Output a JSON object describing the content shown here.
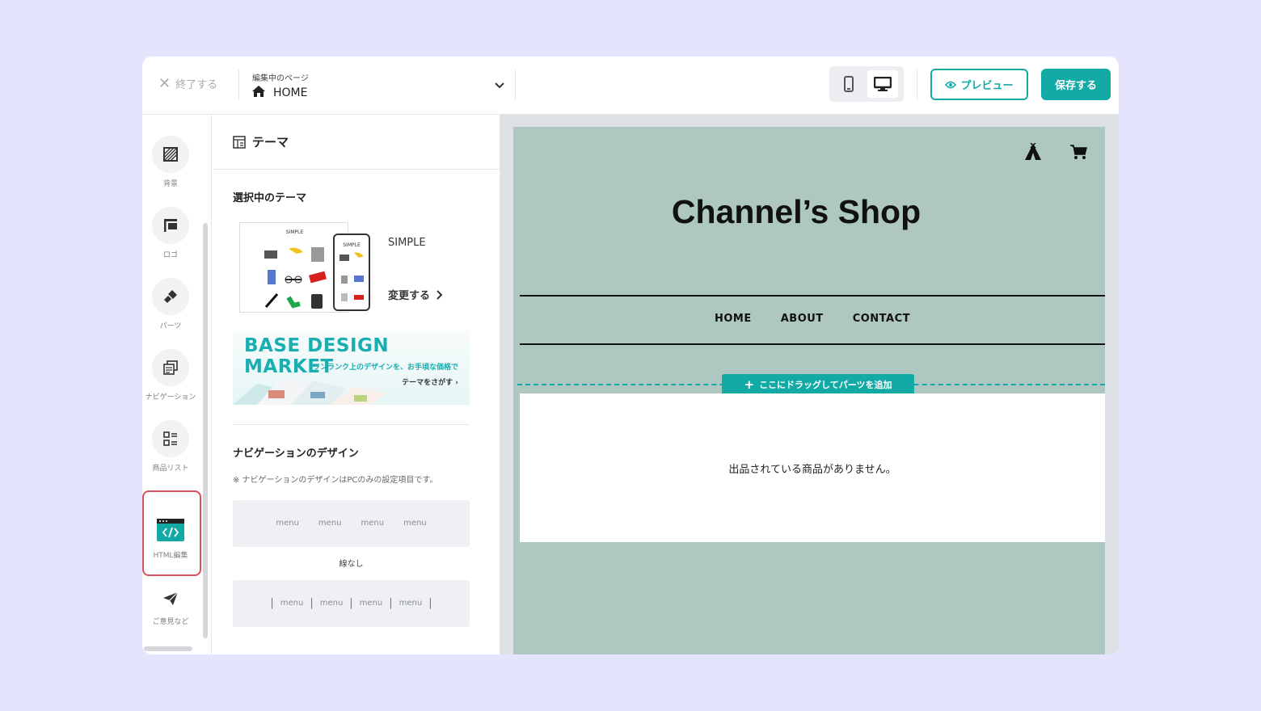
{
  "topbar": {
    "quit_label": "終了する",
    "page_caption": "編集中のページ",
    "page_value": "HOME",
    "preview_label": "プレビュー",
    "save_label": "保存する",
    "active_device": "desktop"
  },
  "rail": {
    "items": [
      {
        "label": "背景",
        "icon": "background-hatch-icon"
      },
      {
        "label": "ロゴ",
        "icon": "flag-icon"
      },
      {
        "label": "パーツ",
        "icon": "brush-icon"
      },
      {
        "label": "ナビゲーション",
        "icon": "navigation-icon"
      },
      {
        "label": "商品リスト",
        "icon": "product-list-icon"
      },
      {
        "label": "HTML編集",
        "icon": "code-window-icon"
      },
      {
        "label": "ご意見など",
        "icon": "paper-plane-icon"
      }
    ],
    "highlighted": "HTML編集"
  },
  "panel": {
    "title": "テーマ",
    "selected_theme_title": "選択中のテーマ",
    "theme_name": "SIMPLE",
    "theme_thumb_label": "SIMPLE",
    "change_label": "変更する",
    "banner": {
      "title": "BASE DESIGN MARKET",
      "subtitle": "ワンランク上のデザインを、お手頃な価格で",
      "link": "テーマをさがす"
    },
    "nav_design_title": "ナビゲーションのデザイン",
    "nav_note": "※ ナビゲーションのデザインはPCのみの設定項目です。",
    "nav_options": [
      {
        "items": [
          "menu",
          "menu",
          "menu",
          "menu"
        ],
        "label": "線なし"
      },
      {
        "items": [
          "menu",
          "menu",
          "menu",
          "menu"
        ],
        "label": ""
      }
    ]
  },
  "preview": {
    "shop_title": "Channel’s Shop",
    "nav": [
      "HOME",
      "ABOUT",
      "CONTACT"
    ],
    "dropzone_label": "ここにドラッグしてパーツを追加",
    "empty_message": "出品されている商品がありません。",
    "bg_color": "#aec8c1",
    "accent_color": "#13aaa6"
  }
}
